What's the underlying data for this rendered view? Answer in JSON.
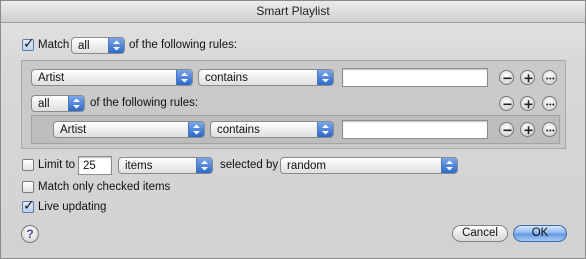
{
  "window": {
    "title": "Smart Playlist"
  },
  "match": {
    "checked": true,
    "label": "Match",
    "quantifier": "all",
    "suffix": "of the following rules:"
  },
  "rule1": {
    "field": "Artist",
    "operator": "contains",
    "value": ""
  },
  "group": {
    "quantifier": "all",
    "suffix": "of the following rules:",
    "rule": {
      "field": "Artist",
      "operator": "contains",
      "value": ""
    }
  },
  "limit": {
    "checked": false,
    "label": "Limit to",
    "value": "25",
    "unit": "items",
    "selected_by_label": "selected by",
    "selected_by": "random"
  },
  "match_checked": {
    "checked": false,
    "label": "Match only checked items"
  },
  "live_updating": {
    "checked": true,
    "label": "Live updating"
  },
  "buttons": {
    "help": "?",
    "cancel": "Cancel",
    "ok": "OK"
  },
  "colors": {
    "accent": "#2c68c8",
    "panel": "#c9c9c9"
  },
  "icons": {
    "remove": "minus-circle-icon",
    "add": "plus-circle-icon",
    "more": "ellipsis-circle-icon",
    "popup": "up-down-chevron-icon",
    "check": "checkmark-icon"
  }
}
